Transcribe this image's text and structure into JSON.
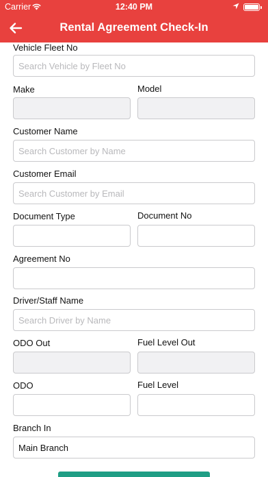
{
  "status_bar": {
    "carrier": "Carrier",
    "time": "12:40 PM",
    "battery_level": 1.0,
    "icons": [
      "wifi-icon",
      "location-arrow-icon",
      "battery-icon"
    ]
  },
  "nav": {
    "title": "Rental Agreement Check-In",
    "back_icon": "arrow-left-icon",
    "color": "#e8413e"
  },
  "form": {
    "vehicle_fleet_no": {
      "label": "Vehicle Fleet No",
      "placeholder": "Search Vehicle by Fleet No",
      "value": ""
    },
    "make": {
      "label": "Make",
      "value": ""
    },
    "model": {
      "label": "Model",
      "value": ""
    },
    "customer_name": {
      "label": "Customer Name",
      "placeholder": "Search Customer by Name",
      "value": ""
    },
    "customer_email": {
      "label": "Customer Email",
      "placeholder": "Search Customer by Email",
      "value": ""
    },
    "document_type": {
      "label": "Document Type",
      "value": ""
    },
    "document_no": {
      "label": "Document No",
      "value": ""
    },
    "agreement_no": {
      "label": "Agreement No",
      "value": ""
    },
    "driver_staff_name": {
      "label": "Driver/Staff Name",
      "placeholder": "Search Driver by Name",
      "value": ""
    },
    "odo_out": {
      "label": "ODO Out",
      "value": ""
    },
    "fuel_level_out": {
      "label": "Fuel Level Out",
      "value": ""
    },
    "odo": {
      "label": "ODO",
      "value": ""
    },
    "fuel_level": {
      "label": "Fuel Level",
      "value": ""
    },
    "branch_in": {
      "label": "Branch In",
      "value": "Main Branch"
    }
  },
  "submit_color": "#1f9e85"
}
